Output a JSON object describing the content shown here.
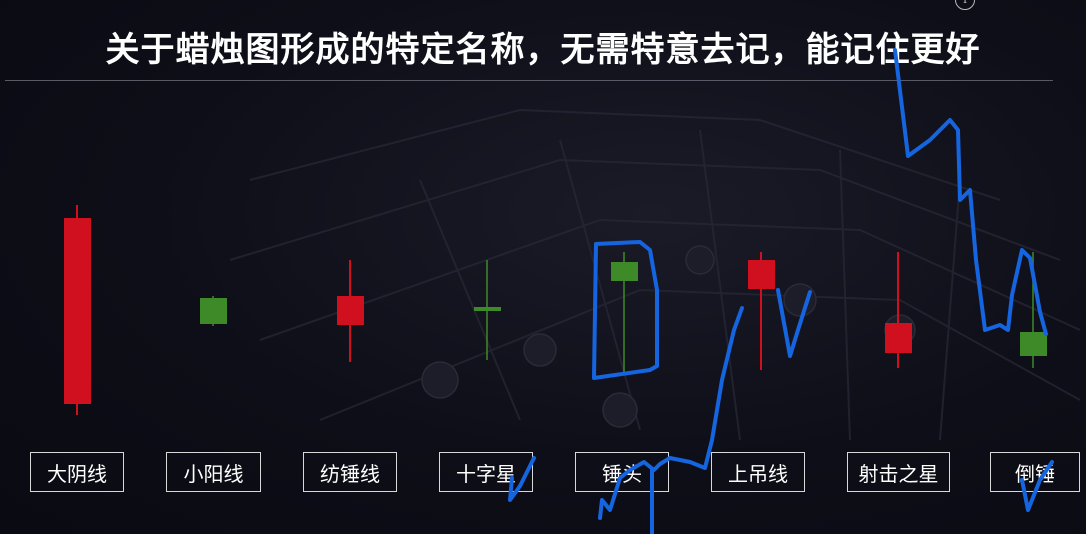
{
  "title": "关于蜡烛图形成的特定名称，无需特意去记，能记住更好",
  "colors": {
    "bullish": "#3e8a28",
    "bearish": "#d0101e",
    "annotation": "#1565e0",
    "background": "#0c0c16"
  },
  "corner_icon": "info-circle-icon",
  "candles": [
    {
      "name": "大阴线",
      "color": "bearish"
    },
    {
      "name": "小阳线",
      "color": "bullish"
    },
    {
      "name": "纺锤线",
      "color": "bearish"
    },
    {
      "name": "十字星",
      "color": "bullish"
    },
    {
      "name": "锤头",
      "color": "bullish"
    },
    {
      "name": "上吊线",
      "color": "bearish"
    },
    {
      "name": "射击之星",
      "color": "bearish"
    },
    {
      "name": "倒锤",
      "color": "bullish"
    }
  ]
}
